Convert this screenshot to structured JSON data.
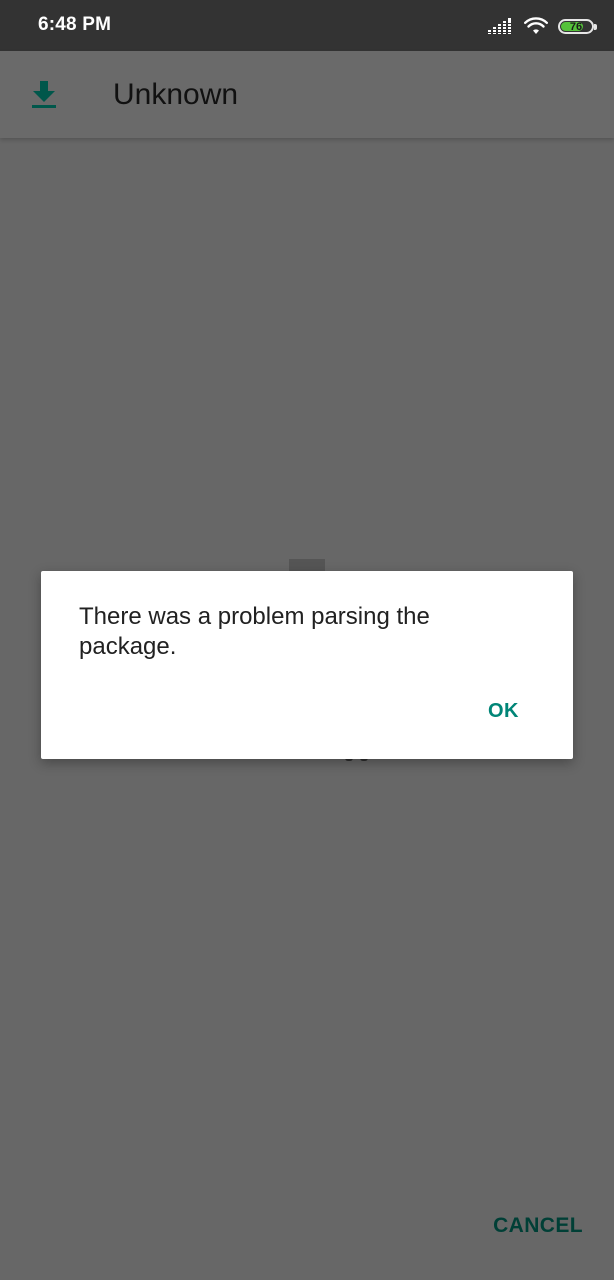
{
  "status_bar": {
    "time": "6:48 PM",
    "battery_level": "76",
    "icons": [
      "signal-icon",
      "wifi-icon",
      "battery-icon"
    ],
    "battery_color": "#55c23a"
  },
  "app_bar": {
    "title": "Unknown",
    "icon": "download-icon",
    "icon_color": "#00574b"
  },
  "dialog": {
    "message": "There was a problem parsing the package.",
    "ok_label": "OK",
    "accent_color": "#008577"
  },
  "footer": {
    "cancel_label": "CANCEL"
  }
}
